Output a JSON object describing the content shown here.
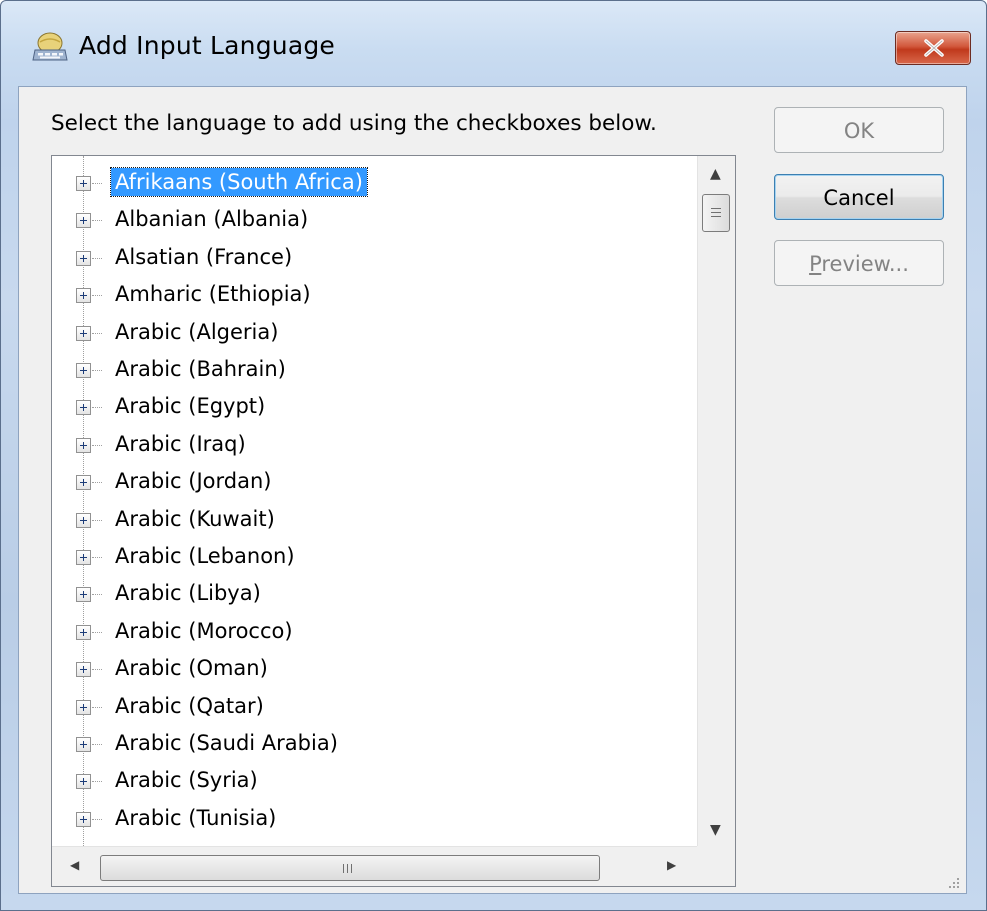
{
  "window": {
    "title": "Add Input Language",
    "icon": "keyboard-globe-icon",
    "close_icon": "close-icon"
  },
  "instruction": "Select the language to add using the checkboxes below.",
  "buttons": {
    "ok": "OK",
    "cancel": "Cancel",
    "preview": "Preview..."
  },
  "language_list": {
    "selected_index": 0,
    "items": [
      {
        "label": "Afrikaans (South Africa)"
      },
      {
        "label": "Albanian (Albania)"
      },
      {
        "label": "Alsatian (France)"
      },
      {
        "label": "Amharic (Ethiopia)"
      },
      {
        "label": "Arabic (Algeria)"
      },
      {
        "label": "Arabic (Bahrain)"
      },
      {
        "label": "Arabic (Egypt)"
      },
      {
        "label": "Arabic (Iraq)"
      },
      {
        "label": "Arabic (Jordan)"
      },
      {
        "label": "Arabic (Kuwait)"
      },
      {
        "label": "Arabic (Lebanon)"
      },
      {
        "label": "Arabic (Libya)"
      },
      {
        "label": "Arabic (Morocco)"
      },
      {
        "label": "Arabic (Oman)"
      },
      {
        "label": "Arabic (Qatar)"
      },
      {
        "label": "Arabic (Saudi Arabia)"
      },
      {
        "label": "Arabic (Syria)"
      },
      {
        "label": "Arabic (Tunisia)"
      }
    ]
  },
  "colors": {
    "selection": "#3399ff",
    "close_button": "#c0391c"
  }
}
